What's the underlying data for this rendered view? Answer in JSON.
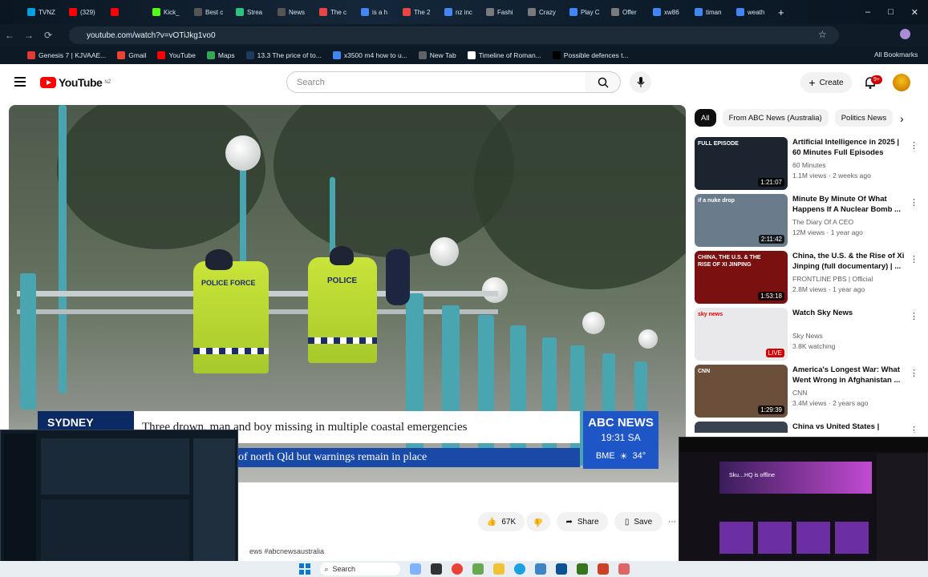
{
  "browser": {
    "tabs": [
      {
        "label": "TVNZ",
        "color": "#00a0e0"
      },
      {
        "label": "(329)",
        "color": "#ff0000"
      },
      {
        "label": "",
        "color": "#ff0000"
      },
      {
        "label": "Kick_",
        "color": "#53fc18"
      },
      {
        "label": "Best c",
        "color": "#555555"
      },
      {
        "label": "Strea",
        "color": "#2ec27e"
      },
      {
        "label": "News",
        "color": "#555555"
      },
      {
        "label": "The c",
        "color": "#e94444"
      },
      {
        "label": "is a h",
        "color": "#4285f4"
      },
      {
        "label": "The 2",
        "color": "#e94444"
      },
      {
        "label": "nz inc",
        "color": "#4285f4"
      },
      {
        "label": "Fashi",
        "color": "#7a7a7a"
      },
      {
        "label": "Crazy",
        "color": "#7a7a7a"
      },
      {
        "label": "Play C",
        "color": "#4285f4"
      },
      {
        "label": "Offer",
        "color": "#7a7a7a"
      },
      {
        "label": "xw86",
        "color": "#4285f4"
      },
      {
        "label": "timan",
        "color": "#4285f4"
      },
      {
        "label": "weath",
        "color": "#4285f4"
      }
    ],
    "new_tab": "+",
    "window_controls": [
      "–",
      "□",
      "✕"
    ],
    "url": "youtube.com/watch?v=vOTiJkg1vo0",
    "bookmarks": [
      {
        "label": "Genesis 7 | KJVAAE...",
        "color": "#e53935"
      },
      {
        "label": "Gmail",
        "color": "#ea4335"
      },
      {
        "label": "YouTube",
        "color": "#ff0000"
      },
      {
        "label": "Maps",
        "color": "#34a853"
      },
      {
        "label": "13.3 The price of to...",
        "color": "#1e3a5f"
      },
      {
        "label": "x3500 m4 how to u...",
        "color": "#4285f4"
      },
      {
        "label": "New Tab",
        "color": "#5f6368"
      },
      {
        "label": "Timeline of Roman...",
        "color": "#ffffff"
      },
      {
        "label": "Possible defences t...",
        "color": "#000000"
      }
    ],
    "all_bookmarks": "All Bookmarks"
  },
  "youtube": {
    "logo_text": "YouTube",
    "logo_region": "NZ",
    "search_placeholder": "Search",
    "create_label": "Create",
    "notification_count": "9+"
  },
  "video": {
    "city_tag": "SYDNEY",
    "headline": "Three drown, man and boy missing in multiple coastal emergencies",
    "ticker": "of north Qld but warnings remain in place",
    "channel_bug": "ABC NEWS",
    "time": "19:31",
    "timezone": "SA",
    "weather_city": "BME",
    "temperature": "34°",
    "vest_text_1": "POLICE FORCE",
    "vest_text_2": "POLICE"
  },
  "actions": {
    "likes": "67K",
    "share": "Share",
    "save": "Save",
    "hashtags": "ews #abcnewsaustralia"
  },
  "chips": [
    "All",
    "From ABC News (Australia)",
    "Politics News"
  ],
  "recommendations": [
    {
      "title": "Artificial Intelligence in 2025 | 60 Minutes Full Episodes",
      "channel": "60 Minutes",
      "meta": "1.1M views · 2 weeks ago",
      "duration": "1:21:07",
      "thumb_label": "FULL EPISODE",
      "bg": "#1c2430",
      "live": false
    },
    {
      "title": "Minute By Minute Of What Happens If A Nuclear Bomb ...",
      "channel": "The Diary Of A CEO",
      "meta": "12M views · 1 year ago",
      "duration": "2:11:42",
      "thumb_label": "if a nuke drop",
      "bg": "#6a7c8c",
      "live": false
    },
    {
      "title": "China, the U.S. & the Rise of Xi Jinping (full documentary) | ...",
      "channel": "FRONTLINE PBS | Official",
      "meta": "2.8M views · 1 year ago",
      "duration": "1:53:18",
      "thumb_label": "CHINA, THE U.S. & THE RISE OF XI JINPING",
      "bg": "#7a1010",
      "live": false
    },
    {
      "title": "Watch Sky News",
      "channel": "Sky News",
      "meta": "3.8K watching",
      "duration": "LIVE",
      "thumb_label": "sky news",
      "bg": "#e9e9ec",
      "live": true
    },
    {
      "title": "America's Longest War: What Went Wrong in Afghanistan ...",
      "channel": "CNN",
      "meta": "3.4M views · 2 years ago",
      "duration": "1:29:39",
      "thumb_label": "CNN",
      "bg": "#6b4f3a",
      "live": false
    },
    {
      "title": "China vs United States | Behind",
      "channel": "",
      "meta": "",
      "duration": "",
      "thumb_label": "",
      "bg": "#3a4250",
      "live": false
    }
  ],
  "taskbar": {
    "search": "Search"
  },
  "overlay2": {
    "text": "Sku…HQ is offline"
  },
  "colors": {
    "yt_red": "#ff0000",
    "abc_blue": "#1e56c8",
    "ticker_blue": "#1a4aa8",
    "city_tag": "#0b2a63"
  }
}
